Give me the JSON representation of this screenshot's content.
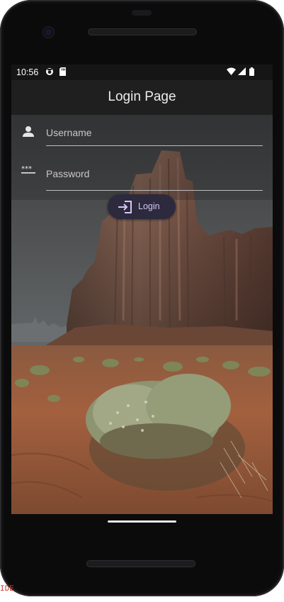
{
  "status_bar": {
    "time": "10:56",
    "left_icons": [
      "sync-icon",
      "sd-card-icon"
    ],
    "right_icons": [
      "wifi-icon",
      "signal-icon",
      "battery-icon"
    ]
  },
  "app_bar": {
    "title": "Login Page"
  },
  "form": {
    "username": {
      "placeholder": "Username",
      "icon": "person-icon"
    },
    "password": {
      "placeholder": "Password",
      "icon": "password-icon"
    },
    "login_button": {
      "label": "Login",
      "icon": "login-icon"
    }
  },
  "background": {
    "scene": "desert-butte-image"
  },
  "colors": {
    "app_bar": "#1f1f1f",
    "button_bg": "#2d2a3d",
    "button_text": "#d4c6f5"
  },
  "edge_text": "IDE"
}
